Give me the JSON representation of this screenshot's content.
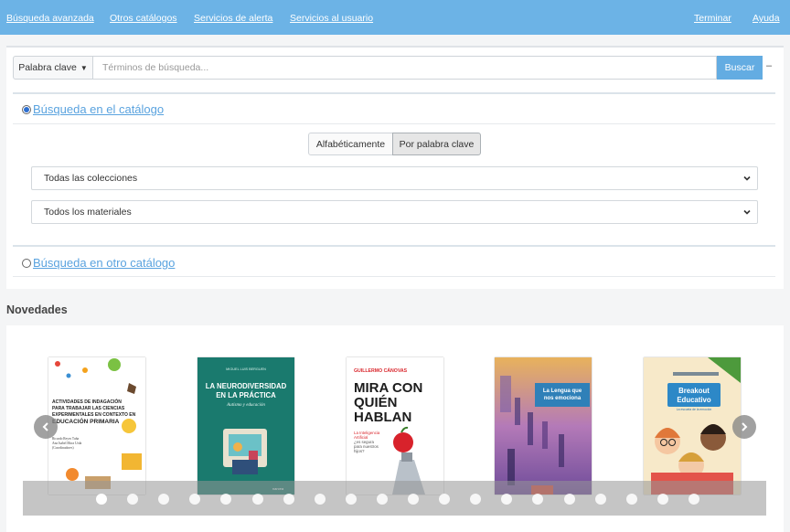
{
  "nav": {
    "left": [
      "Búsqueda avanzada",
      "Otros catálogos",
      "Servicios de alerta",
      "Servicios al usuario"
    ],
    "right": [
      "Terminar",
      "Ayuda"
    ]
  },
  "search": {
    "type_button": "Palabra clave",
    "placeholder": "Términos de búsqueda...",
    "submit": "Buscar",
    "collapse_glyph": "–"
  },
  "catalog": {
    "radio_label": "Búsqueda en el catálogo",
    "selected": true,
    "mode_alpha": "Alfabéticamente",
    "mode_keyword": "Por palabra clave",
    "active_mode": "keyword",
    "collections": "Todas las colecciones",
    "materials": "Todos los materiales"
  },
  "other_catalog": {
    "radio_label": "Búsqueda en otro catálogo",
    "selected": false
  },
  "novedades": {
    "title": "Novedades",
    "books": [
      {
        "title_lines": [
          "ACTIVIDADES DE INDAGACIÓN",
          "PARA TRABAJAR LAS CIENCIAS",
          "EXPERIMENTALES EN CONTEXTO EN",
          "EDUCACIÓN PRIMARIA"
        ],
        "authors": [
          "Ricardo Reyes Tuña",
          "Ana Isabel Mora Urda",
          "(Coordinadores)"
        ]
      },
      {
        "author": "MIGUEL LUIS BERGUEN",
        "title_lines": [
          "LA NEURODIVERSIDAD",
          "EN LA PRÁCTICA"
        ],
        "subtitle": "Autismo y educación",
        "publisher": "narcea"
      },
      {
        "author": "GUILLERMO CÁNOVAS",
        "title_lines": [
          "MIRA CON",
          "QUIÉN",
          "HABLAN"
        ],
        "tagline": [
          "La Inteligencia",
          "Artificial",
          "¿es segura",
          "para nuestros",
          "hijos?"
        ]
      },
      {
        "title_lines": [
          "La Lengua que",
          "nos emociona"
        ]
      },
      {
        "title_lines": [
          "Breakout",
          "Educativo"
        ],
        "subtitle": "La escuela de la emoción"
      }
    ],
    "dots_total": 20,
    "active_dot": 0
  },
  "colors": {
    "topbar": "#6cb3e6",
    "link": "#5aa3df",
    "button": "#63ace2"
  }
}
